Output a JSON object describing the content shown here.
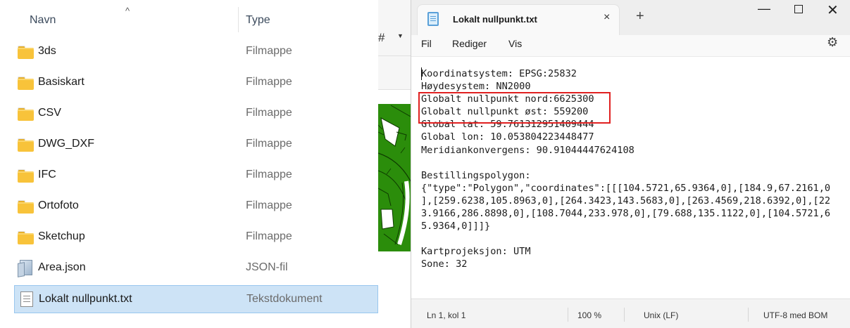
{
  "explorer": {
    "columns": {
      "name": "Navn",
      "type": "Type"
    },
    "items": [
      {
        "name": "3ds",
        "type": "Filmappe",
        "icon": "folder-icon"
      },
      {
        "name": "Basiskart",
        "type": "Filmappe",
        "icon": "folder-icon"
      },
      {
        "name": "CSV",
        "type": "Filmappe",
        "icon": "folder-icon"
      },
      {
        "name": "DWG_DXF",
        "type": "Filmappe",
        "icon": "folder-icon"
      },
      {
        "name": "IFC",
        "type": "Filmappe",
        "icon": "folder-icon"
      },
      {
        "name": "Ortofoto",
        "type": "Filmappe",
        "icon": "folder-icon"
      },
      {
        "name": "Sketchup",
        "type": "Filmappe",
        "icon": "folder-icon"
      },
      {
        "name": "Area.json",
        "type": "JSON-fil",
        "icon": "json-file-icon"
      },
      {
        "name": "Lokalt nullpunkt.txt",
        "type": "Tekstdokument",
        "icon": "text-file-icon",
        "selected": true
      }
    ]
  },
  "middle": {
    "toolbar_glyph": "#",
    "map_color": "#2b8d0b"
  },
  "notepad": {
    "tab_title": "Lokalt nullpunkt.txt",
    "tab_close_glyph": "×",
    "new_tab_glyph": "+",
    "window": {
      "minimize": "—",
      "close": "✕"
    },
    "menu": {
      "file": "Fil",
      "edit": "Rediger",
      "view": "Vis"
    },
    "settings_icon": "gear-icon",
    "content_lines": [
      "Koordinatsystem: EPSG:25832",
      "Høydesystem: NN2000",
      "Globalt nullpunkt nord:6625300",
      "Globalt nullpunkt øst: 559200",
      "Global lat: 59.761312951409444",
      "Global lon: 10.053804223448477",
      "Meridiankonvergens: 90.91044447624108",
      "",
      "Bestillingspolygon:",
      "{\"type\":\"Polygon\",\"coordinates\":[[[104.5721,65.9364,0],[184.9,67.2161,0",
      "],[259.6238,105.8963,0],[264.3423,143.5683,0],[263.4569,218.6392,0],[22",
      "3.9166,286.8898,0],[108.7044,233.978,0],[79.688,135.1122,0],[104.5721,6",
      "5.9364,0]]]}",
      "",
      "Kartprojeksjon: UTM",
      "Sone: 32"
    ],
    "highlight_color": "#e02020",
    "status": {
      "position": "Ln 1, kol 1",
      "zoom": "100 %",
      "line_ending": "Unix (LF)",
      "encoding": "UTF-8 med BOM"
    }
  }
}
